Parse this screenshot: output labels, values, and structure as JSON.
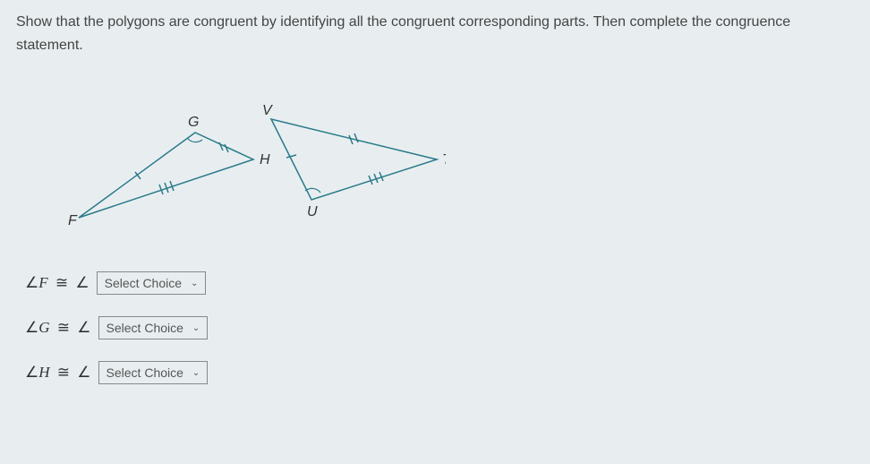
{
  "question": "Show that the polygons are congruent by identifying all the congruent corresponding parts. Then complete the congruence statement.",
  "diagram": {
    "triangle1": {
      "vertices": [
        "F",
        "G",
        "H"
      ]
    },
    "triangle2": {
      "vertices": [
        "V",
        "U",
        "T"
      ]
    }
  },
  "labels": {
    "F": "F",
    "G": "G",
    "H": "H",
    "V": "V",
    "U": "U",
    "T": "T"
  },
  "rows": [
    {
      "left": "F",
      "select": "Select Choice"
    },
    {
      "left": "G",
      "select": "Select Choice"
    },
    {
      "left": "H",
      "select": "Select Choice"
    }
  ],
  "symbols": {
    "angle": "∠",
    "congruent": "≅",
    "chevron": "⌄"
  }
}
